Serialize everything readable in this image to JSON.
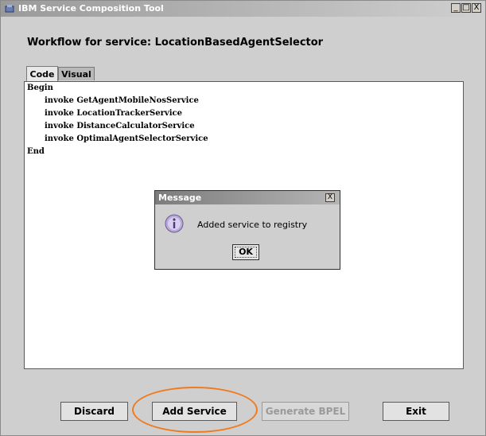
{
  "window": {
    "title": "IBM Service Composition Tool",
    "min_glyph": "_",
    "max_glyph": "□",
    "close_glyph": "X"
  },
  "workflow": {
    "label": "Workflow for service: LocationBasedAgentSelector"
  },
  "tabs": [
    {
      "label": "Code",
      "selected": true
    },
    {
      "label": "Visual",
      "selected": false
    }
  ],
  "code": {
    "lines": [
      "Begin",
      "invoke GetAgentMobileNosService",
      "invoke LocationTrackerService",
      "invoke DistanceCalculatorService",
      "invoke OptimalAgentSelectorService",
      "End"
    ]
  },
  "dialog": {
    "title": "Message",
    "close_glyph": "X",
    "message": "Added service to registry",
    "ok_label": "OK"
  },
  "buttons": {
    "discard": "Discard",
    "add_service": "Add Service",
    "generate_bpel": "Generate BPEL",
    "exit": "Exit"
  },
  "colors": {
    "highlight": "#f07a1e",
    "window_bg": "#cfcfcf"
  }
}
